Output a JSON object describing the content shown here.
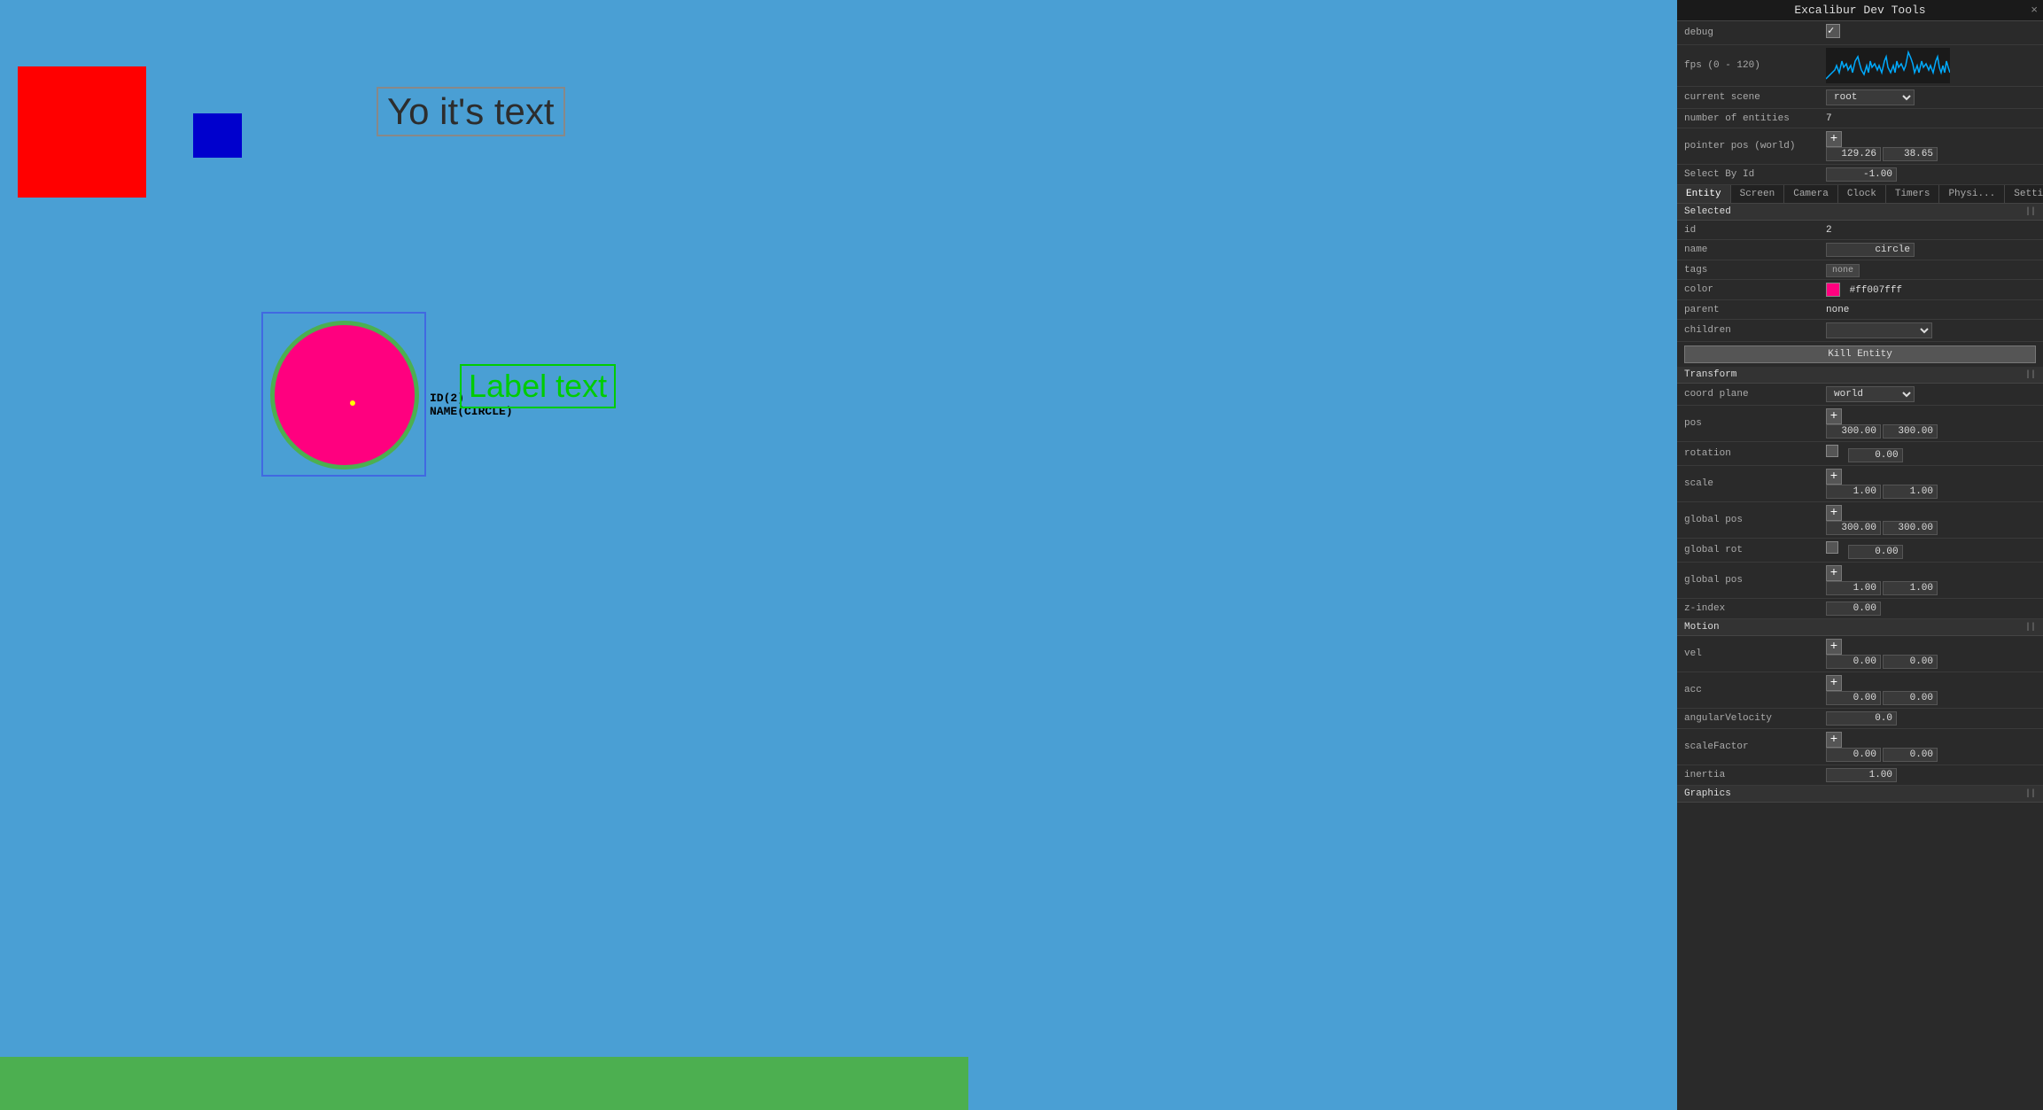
{
  "game": {
    "canvas_bg": "#4a9fd4",
    "yo_text": "Yo it's text",
    "label_text": "Label text",
    "circle_id_label": "ID(2)",
    "circle_name_label": "NAME(CIRCLE)"
  },
  "devtools": {
    "title": "Excalibur Dev Tools",
    "close_label": "×",
    "rows": {
      "debug_label": "debug",
      "fps_label": "fps (0 - 120)",
      "current_scene_label": "current scene",
      "current_scene_value": "root",
      "num_entities_label": "number of entities",
      "num_entities_value": "7",
      "pointer_pos_label": "pointer pos (world)",
      "pointer_pos_x": "129.26",
      "pointer_pos_y": "38.65",
      "select_by_id_label": "Select By Id",
      "select_by_id_value": "-1.00"
    },
    "tabs": [
      {
        "label": "Entity",
        "active": true
      },
      {
        "label": "Screen",
        "active": false
      },
      {
        "label": "Camera",
        "active": false
      },
      {
        "label": "Clock",
        "active": false
      },
      {
        "label": "Timers",
        "active": false
      },
      {
        "label": "Physi...",
        "active": false
      },
      {
        "label": "Setti...",
        "active": false
      }
    ],
    "selected_section": {
      "title": "Selected",
      "id_label": "id",
      "id_value": "2",
      "name_label": "name",
      "name_value": "circle",
      "tags_label": "tags",
      "tags_value": "none",
      "color_label": "color",
      "color_value": "#ff007fff",
      "parent_label": "parent",
      "parent_value": "none",
      "children_label": "children",
      "children_value": "",
      "kill_btn_label": "Kill Entity"
    },
    "transform_section": {
      "title": "Transform",
      "coord_plane_label": "coord plane",
      "coord_plane_value": "world",
      "pos_label": "pos",
      "pos_x": "300.00",
      "pos_y": "300.00",
      "rotation_label": "rotation",
      "rotation_value": "0.00",
      "scale_label": "scale",
      "scale_x": "1.00",
      "scale_y": "1.00",
      "global_pos_label": "global pos",
      "global_pos_x": "300.00",
      "global_pos_y": "300.00",
      "global_rot_label": "global rot",
      "global_rot_value": "0.00",
      "global_pos2_label": "global pos",
      "global_pos2_x": "1.00",
      "global_pos2_y": "1.00",
      "z_index_label": "z-index",
      "z_index_value": "0.00"
    },
    "motion_section": {
      "title": "Motion",
      "vel_label": "vel",
      "vel_x": "0.00",
      "vel_y": "0.00",
      "acc_label": "acc",
      "acc_x": "0.00",
      "acc_y": "0.00",
      "angular_velocity_label": "angularVelocity",
      "angular_velocity_value": "0.0",
      "scale_factor_label": "scaleFactor",
      "scale_factor_x": "0.00",
      "scale_factor_y": "0.00",
      "inertia_label": "inertia",
      "inertia_value": "1.00"
    },
    "graphics_section": {
      "title": "Graphics"
    }
  }
}
